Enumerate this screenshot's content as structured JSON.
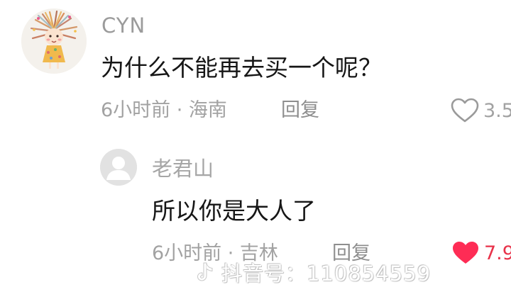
{
  "comment": {
    "username": "CYN",
    "text": "为什么不能再去买一个呢？",
    "meta": "6小时前 · 海南",
    "reply_label": "回复",
    "like_count": "3.5",
    "liked": false,
    "avatar_icon": "cartoon-girl-avatar"
  },
  "reply": {
    "username": "老君山",
    "text": "所以你是大人了",
    "meta": "6小时前 · 吉林",
    "reply_label": "回复",
    "like_count": "7.9",
    "liked": true,
    "avatar_icon": "default-user-avatar"
  },
  "watermark": {
    "text": "抖音号：110854559",
    "icon": "douyin-logo-icon"
  },
  "colors": {
    "like_active": "#fe2c55",
    "meta_text": "#a2a2a2",
    "main_text": "#161616"
  }
}
